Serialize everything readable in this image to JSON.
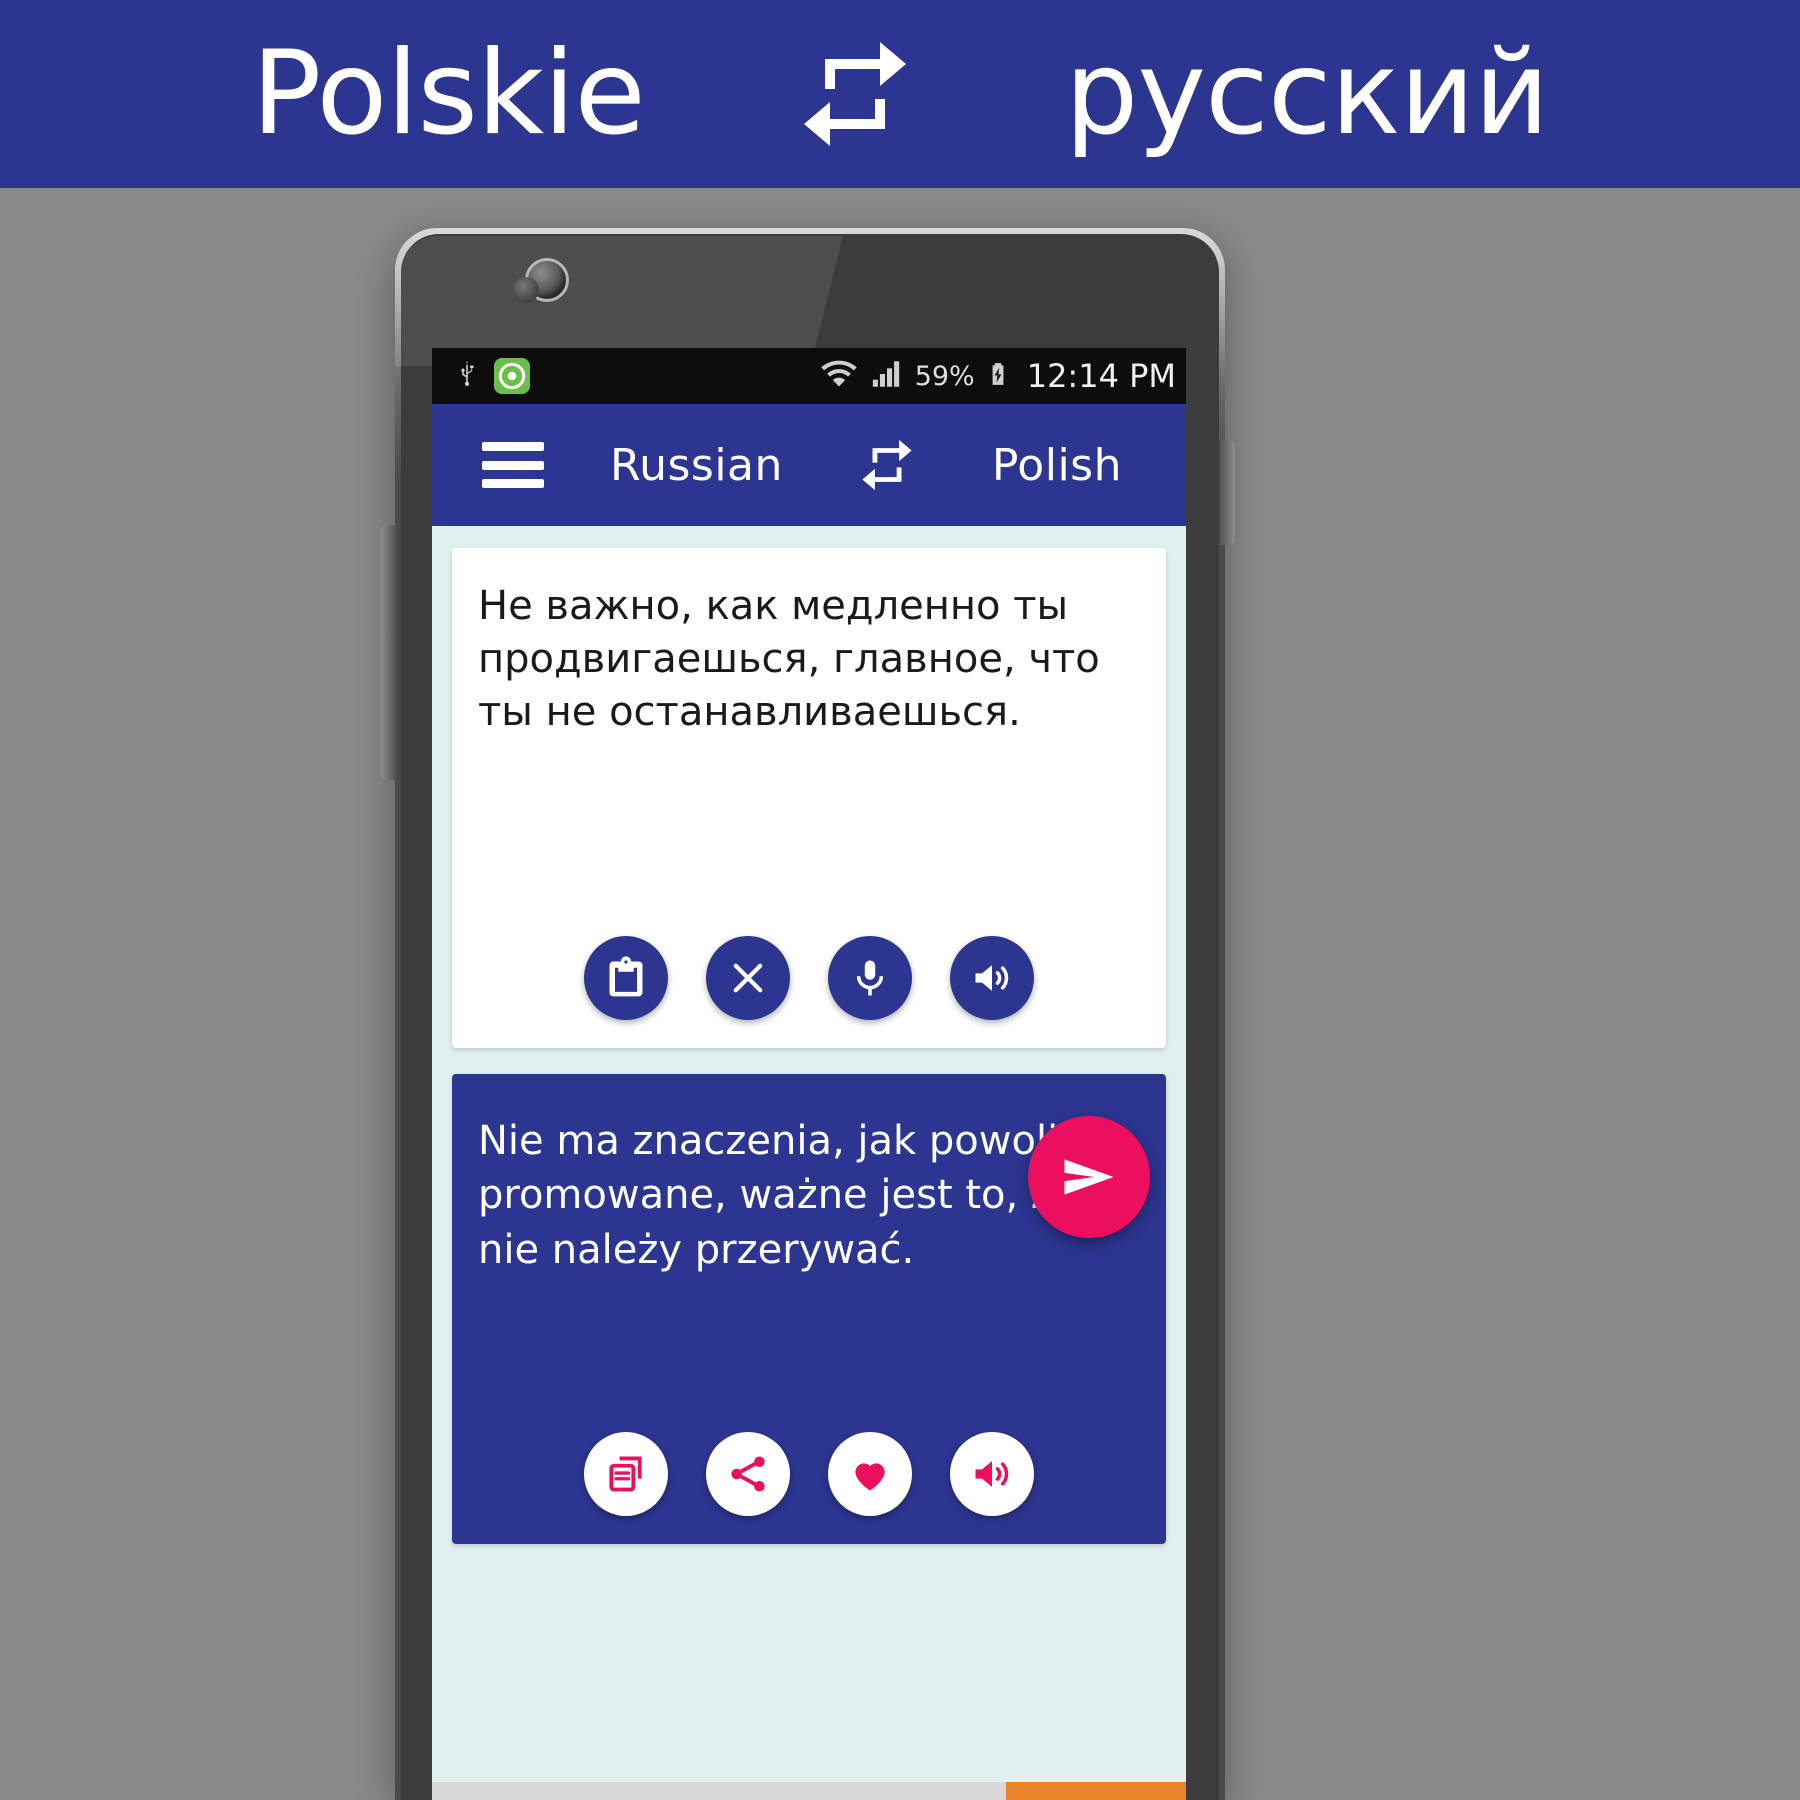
{
  "promo": {
    "left_language": "Polskie",
    "right_language": "русский",
    "swap_icon": "swap-repeat-icon",
    "background_color": "#2c3590",
    "text_color": "#ffffff"
  },
  "device": {
    "statusbar": {
      "usb_icon": "usb-icon",
      "app_icon": "app-notification-icon",
      "wifi_icon": "wifi-icon",
      "signal_icon": "cellular-signal-icon",
      "battery_percent": "59%",
      "battery_icon": "battery-charging-icon",
      "clock": "12:14 PM",
      "background_color": "#0d0d0d"
    },
    "toolbar": {
      "menu_icon": "hamburger-menu-icon",
      "source_language": "Russian",
      "swap_icon": "swap-languages-icon",
      "target_language": "Polish",
      "background_color": "#2c3590"
    },
    "source_panel": {
      "text": "Не важно, как медленно ты продвигаешься, главное, что ты не останавливаешься.",
      "background_color": "#ffffff",
      "text_color": "#1a1a1a",
      "buttons": [
        {
          "name": "paste-button",
          "icon": "clipboard-paste-icon"
        },
        {
          "name": "clear-button",
          "icon": "close-x-icon"
        },
        {
          "name": "voice-input-button",
          "icon": "microphone-icon"
        },
        {
          "name": "speak-source-button",
          "icon": "speaker-volume-icon"
        }
      ],
      "button_color": "#2c3590",
      "button_icon_color": "#ffffff"
    },
    "target_panel": {
      "text": "Nie ma znaczenia, jak powoli są promowane, ważne jest to, że nie należy przerywać.",
      "background_color": "#2c3590",
      "text_color": "#ffffff",
      "buttons": [
        {
          "name": "copy-button",
          "icon": "copy-icon"
        },
        {
          "name": "share-button",
          "icon": "share-icon"
        },
        {
          "name": "favorite-button",
          "icon": "heart-icon"
        },
        {
          "name": "speak-target-button",
          "icon": "speaker-volume-icon"
        }
      ],
      "button_color": "#ffffff",
      "button_icon_color": "#ec0f5e"
    },
    "send_button": {
      "name": "translate-send-button",
      "icon": "send-paper-plane-icon",
      "color": "#ec0f5e"
    }
  }
}
